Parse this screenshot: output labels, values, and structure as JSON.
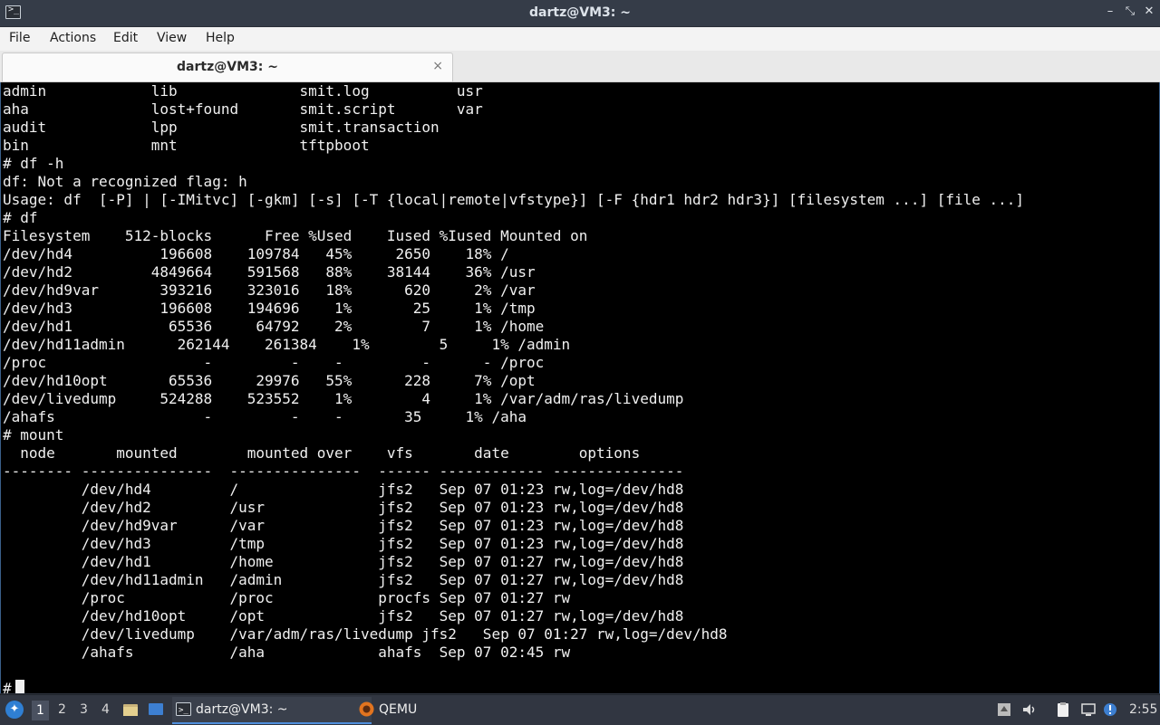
{
  "window": {
    "title": "dartz@VM3: ~",
    "controls": {
      "minimize": "–",
      "restore": "⤡",
      "close": "✕"
    }
  },
  "menu": [
    "File",
    "Actions",
    "Edit",
    "View",
    "Help"
  ],
  "tab": {
    "label": "dartz@VM3: ~",
    "close": "×"
  },
  "terminal": {
    "lines": [
      "admin            lib              smit.log          usr",
      "aha              lost+found       smit.script       var",
      "audit            lpp              smit.transaction",
      "bin              mnt              tftpboot",
      "# df -h",
      "df: Not a recognized flag: h",
      "Usage: df  [-P] | [-IMitvc] [-gkm] [-s] [-T {local|remote|vfstype}] [-F {hdr1 hdr2 hdr3}] [filesystem ...] [file ...]",
      "# df",
      "Filesystem    512-blocks      Free %Used    Iused %Iused Mounted on",
      "/dev/hd4          196608    109784   45%     2650    18% /",
      "/dev/hd2         4849664    591568   88%    38144    36% /usr",
      "/dev/hd9var       393216    323016   18%      620     2% /var",
      "/dev/hd3          196608    194696    1%       25     1% /tmp",
      "/dev/hd1           65536     64792    2%        7     1% /home",
      "/dev/hd11admin      262144    261384    1%        5     1% /admin",
      "/proc                  -         -    -         -      - /proc",
      "/dev/hd10opt       65536     29976   55%      228     7% /opt",
      "/dev/livedump     524288    523552    1%        4     1% /var/adm/ras/livedump",
      "/ahafs                 -         -    -       35     1% /aha",
      "# mount",
      "  node       mounted        mounted over    vfs       date        options",
      "-------- ---------------  ---------------  ------ ------------ ---------------",
      "         /dev/hd4         /                jfs2   Sep 07 01:23 rw,log=/dev/hd8",
      "         /dev/hd2         /usr             jfs2   Sep 07 01:23 rw,log=/dev/hd8",
      "         /dev/hd9var      /var             jfs2   Sep 07 01:23 rw,log=/dev/hd8",
      "         /dev/hd3         /tmp             jfs2   Sep 07 01:23 rw,log=/dev/hd8",
      "         /dev/hd1         /home            jfs2   Sep 07 01:27 rw,log=/dev/hd8",
      "         /dev/hd11admin   /admin           jfs2   Sep 07 01:27 rw,log=/dev/hd8",
      "         /proc            /proc            procfs Sep 07 01:27 rw",
      "         /dev/hd10opt     /opt             jfs2   Sep 07 01:27 rw,log=/dev/hd8",
      "         /dev/livedump    /var/adm/ras/livedump jfs2   Sep 07 01:27 rw,log=/dev/hd8",
      "         /ahafs           /aha             ahafs  Sep 07 02:45 rw",
      ""
    ],
    "prompt": "#"
  },
  "taskbar": {
    "workspaces": [
      "1",
      "2",
      "3",
      "4"
    ],
    "active_workspace": "1",
    "tasks": [
      {
        "label": "dartz@VM3: ~",
        "icon": "terminal-icon"
      },
      {
        "label": "QEMU",
        "icon": "qemu-icon"
      }
    ],
    "clock": "2:55"
  },
  "colors": {
    "titlebar": "#353c48",
    "terminal_bg": "#000000",
    "terminal_fg": "#f0f0f0",
    "taskbar": "#313641",
    "accent": "#4f8fdc"
  }
}
